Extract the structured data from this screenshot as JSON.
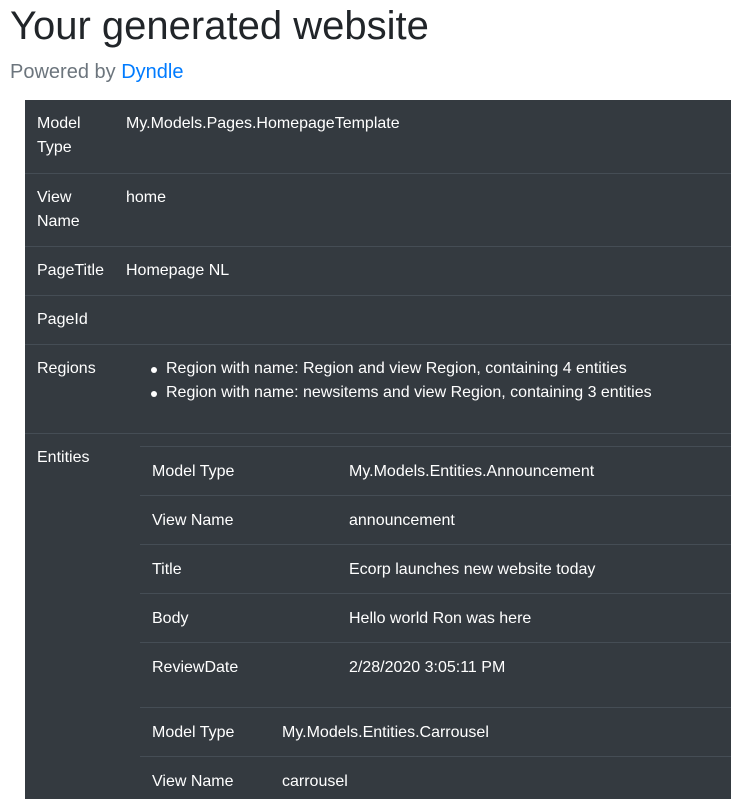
{
  "header": {
    "title": "Your generated website",
    "powered_prefix": "Powered by",
    "powered_link": "Dyndle"
  },
  "page": {
    "rows": [
      {
        "label": "Model Type",
        "value": "My.Models.Pages.HomepageTemplate"
      },
      {
        "label": "View Name",
        "value": "home"
      },
      {
        "label": "PageTitle",
        "value": "Homepage NL"
      },
      {
        "label": "PageId",
        "value": ""
      }
    ],
    "regions_label": "Regions",
    "regions": [
      "Region with name: Region and view Region, containing 4 entities",
      "Region with name: newsitems and view Region, containing 3 entities"
    ],
    "entities_label": "Entities",
    "entities": [
      {
        "rows": [
          {
            "label": "Model Type",
            "value": "My.Models.Entities.Announcement"
          },
          {
            "label": "View Name",
            "value": "announcement"
          },
          {
            "label": "Title",
            "value": "Ecorp launches new website today"
          },
          {
            "label": "Body",
            "value": "Hello world Ron was here"
          },
          {
            "label": "ReviewDate",
            "value": "2/28/2020 3:05:11 PM"
          }
        ]
      },
      {
        "rows": [
          {
            "label": "Model Type",
            "value": "My.Models.Entities.Carrousel"
          },
          {
            "label": "View Name",
            "value": "carrousel"
          }
        ]
      }
    ]
  }
}
